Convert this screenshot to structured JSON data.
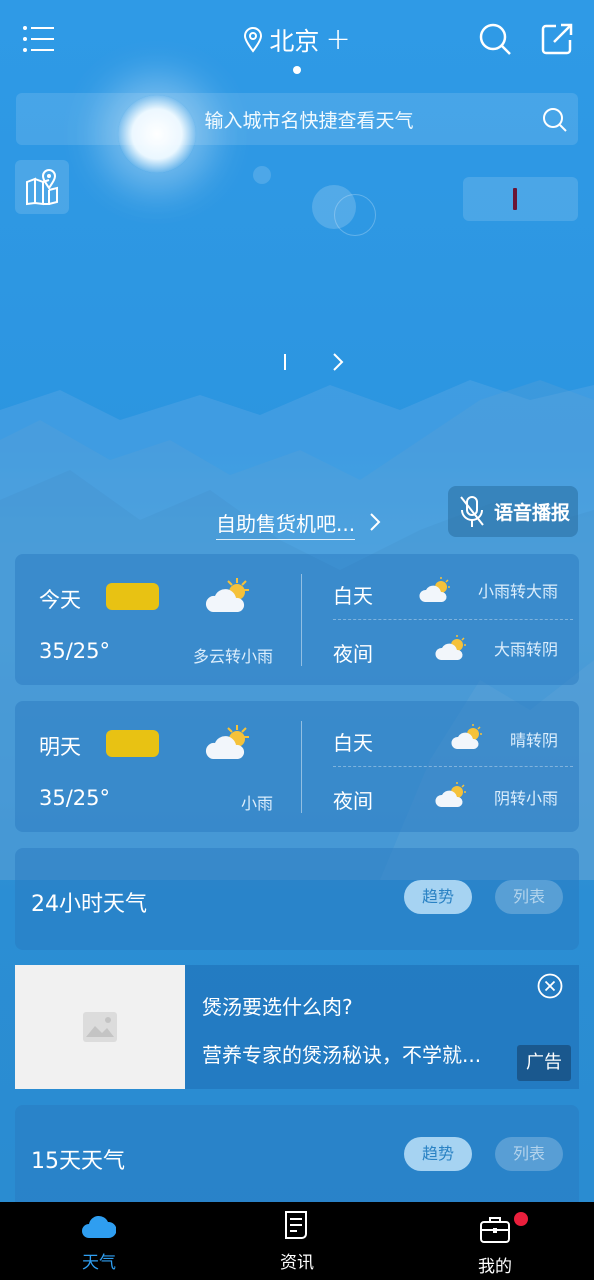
{
  "header": {
    "city": "北京",
    "add_city_glyph": "+",
    "search_placeholder": "输入城市名快捷查看天气"
  },
  "tip": {
    "link_text": "自助售货机吧..."
  },
  "voice": {
    "label": "语音播报"
  },
  "forecast": [
    {
      "day": "今天",
      "temp": "35/25°",
      "weather": "多云转小雨",
      "aqi_color": "#e8c213",
      "day_label": "白天",
      "day_weather": "小雨转大雨",
      "night_label": "夜间",
      "night_weather": "大雨转阴",
      "icon": "partly-cloudy-icon"
    },
    {
      "day": "明天",
      "temp": "35/25°",
      "weather": "小雨",
      "aqi_color": "#e8c213",
      "day_label": "白天",
      "day_weather": "晴转阴",
      "night_label": "夜间",
      "night_weather": "阴转小雨",
      "icon": "partly-cloudy-icon"
    }
  ],
  "hourly": {
    "title": "24小时天气",
    "trend_label": "趋势",
    "list_label": "列表"
  },
  "ad": {
    "title": "煲汤要选什么肉?",
    "description": "营养专家的煲汤秘诀，不学就...",
    "tag": "广告"
  },
  "fifteen_day": {
    "title": "15天天气",
    "trend_label": "趋势",
    "list_label": "列表"
  },
  "nav": {
    "items": [
      {
        "label": "天气",
        "icon": "cloud-icon",
        "active": true
      },
      {
        "label": "资讯",
        "icon": "news-icon",
        "active": false
      },
      {
        "label": "我的",
        "icon": "briefcase-icon",
        "active": false
      }
    ]
  },
  "colors": {
    "accent": "#2f9ef0",
    "aqi_moderate": "#e8c213",
    "badge": "#ea1f3c"
  }
}
